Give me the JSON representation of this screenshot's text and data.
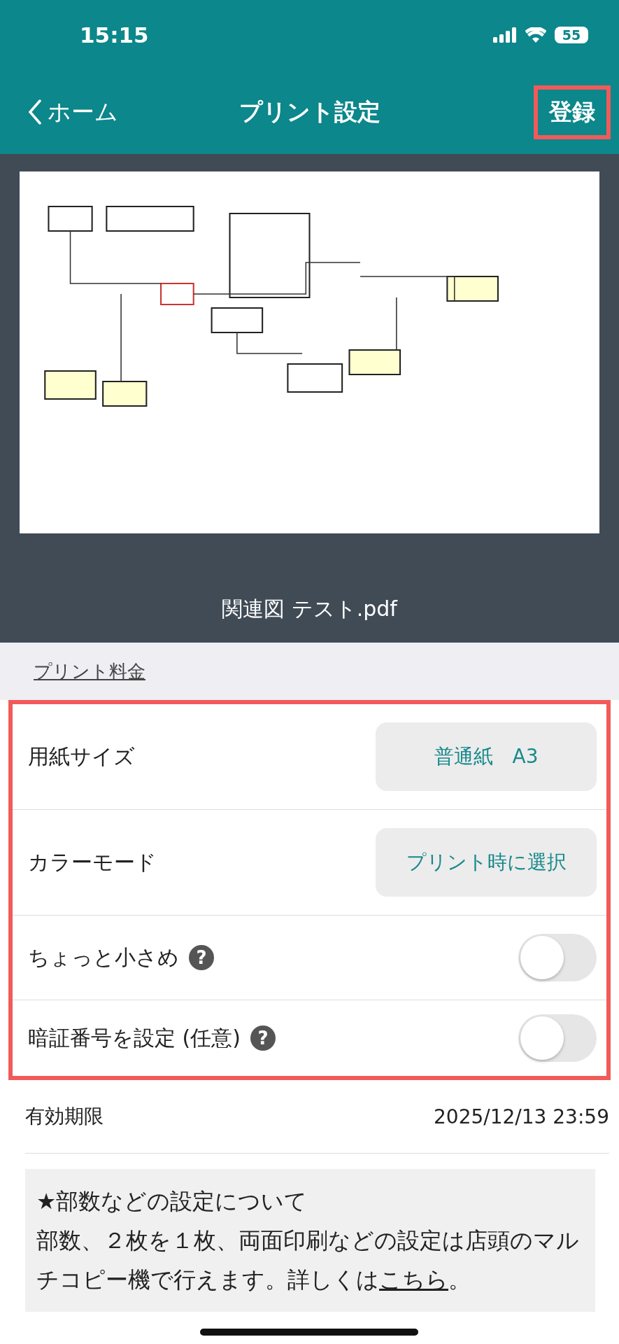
{
  "status_bar": {
    "time": "15:15",
    "battery": "55"
  },
  "nav": {
    "back": "ホーム",
    "title": "プリント設定",
    "action": {
      "label": "登録",
      "highlighted": true
    }
  },
  "preview": {
    "kind": "picture",
    "filename": "関連図 テスト.pdf"
  },
  "price_link": "プリント料金",
  "settings": {
    "highlighted": true,
    "rows": [
      {
        "kind": "select",
        "label": "用紙サイズ",
        "value": "普通紙　A3"
      },
      {
        "kind": "select",
        "label": "カラーモード",
        "value": "プリント時に選択"
      },
      {
        "kind": "toggle",
        "label": "ちょっと小さめ",
        "help": "?",
        "on": false
      },
      {
        "kind": "toggle",
        "label": "暗証番号を設定 (任意)",
        "help": "?",
        "on": false
      }
    ]
  },
  "expiry": {
    "label": "有効期限",
    "value": "2025/12/13 23:59"
  },
  "note": {
    "title": "★部数などの設定について",
    "body": "部数、２枚を１枚、両面印刷などの設定は店頭のマルチコピー機で行えます。詳しくは",
    "link": "こちら",
    "end": "。"
  }
}
